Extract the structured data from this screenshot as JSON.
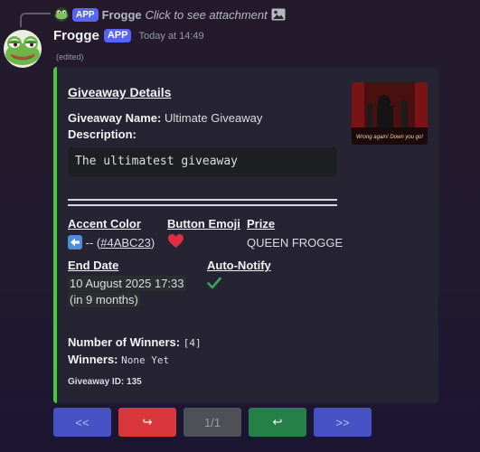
{
  "reply": {
    "author": "Frogge",
    "badge": "APP",
    "text": "Click to see attachment"
  },
  "message": {
    "author": "Frogge",
    "badge": "APP",
    "timestamp": "Today at 14:49",
    "edited": "(edited)"
  },
  "embed": {
    "accent_color": "#46c93a",
    "title": "Giveaway Details",
    "name_label": "Giveaway Name:",
    "name_value": "Ultimate Giveaway",
    "description_label": "Description:",
    "description_value": "The ultimatest giveaway",
    "thumbnail_caption": "Wrong again! Down you go!",
    "fields": {
      "accent_color_label": "Accent Color",
      "accent_color_value": "-- (#4ABC23)",
      "button_emoji_label": "Button Emoji",
      "prize_label": "Prize",
      "prize_value": "QUEEN FROGGE",
      "end_date_label": "End Date",
      "end_date_value": "10 August 2025 17:33",
      "end_date_relative": "(in 9 months)",
      "auto_notify_label": "Auto-Notify"
    },
    "winners_count_label": "Number of Winners:",
    "winners_count_value": "[4]",
    "winners_label": "Winners:",
    "winners_value": "None Yet",
    "giveaway_id": "Giveaway ID: 135"
  },
  "buttons": {
    "first": "<<",
    "prev": "↪",
    "page": "1/1",
    "next": "↩",
    "last": ">>"
  },
  "colors": {
    "blurple": "#5865f2",
    "embed_accent": "#46c93a",
    "red": "#da373c",
    "green": "#248046"
  }
}
